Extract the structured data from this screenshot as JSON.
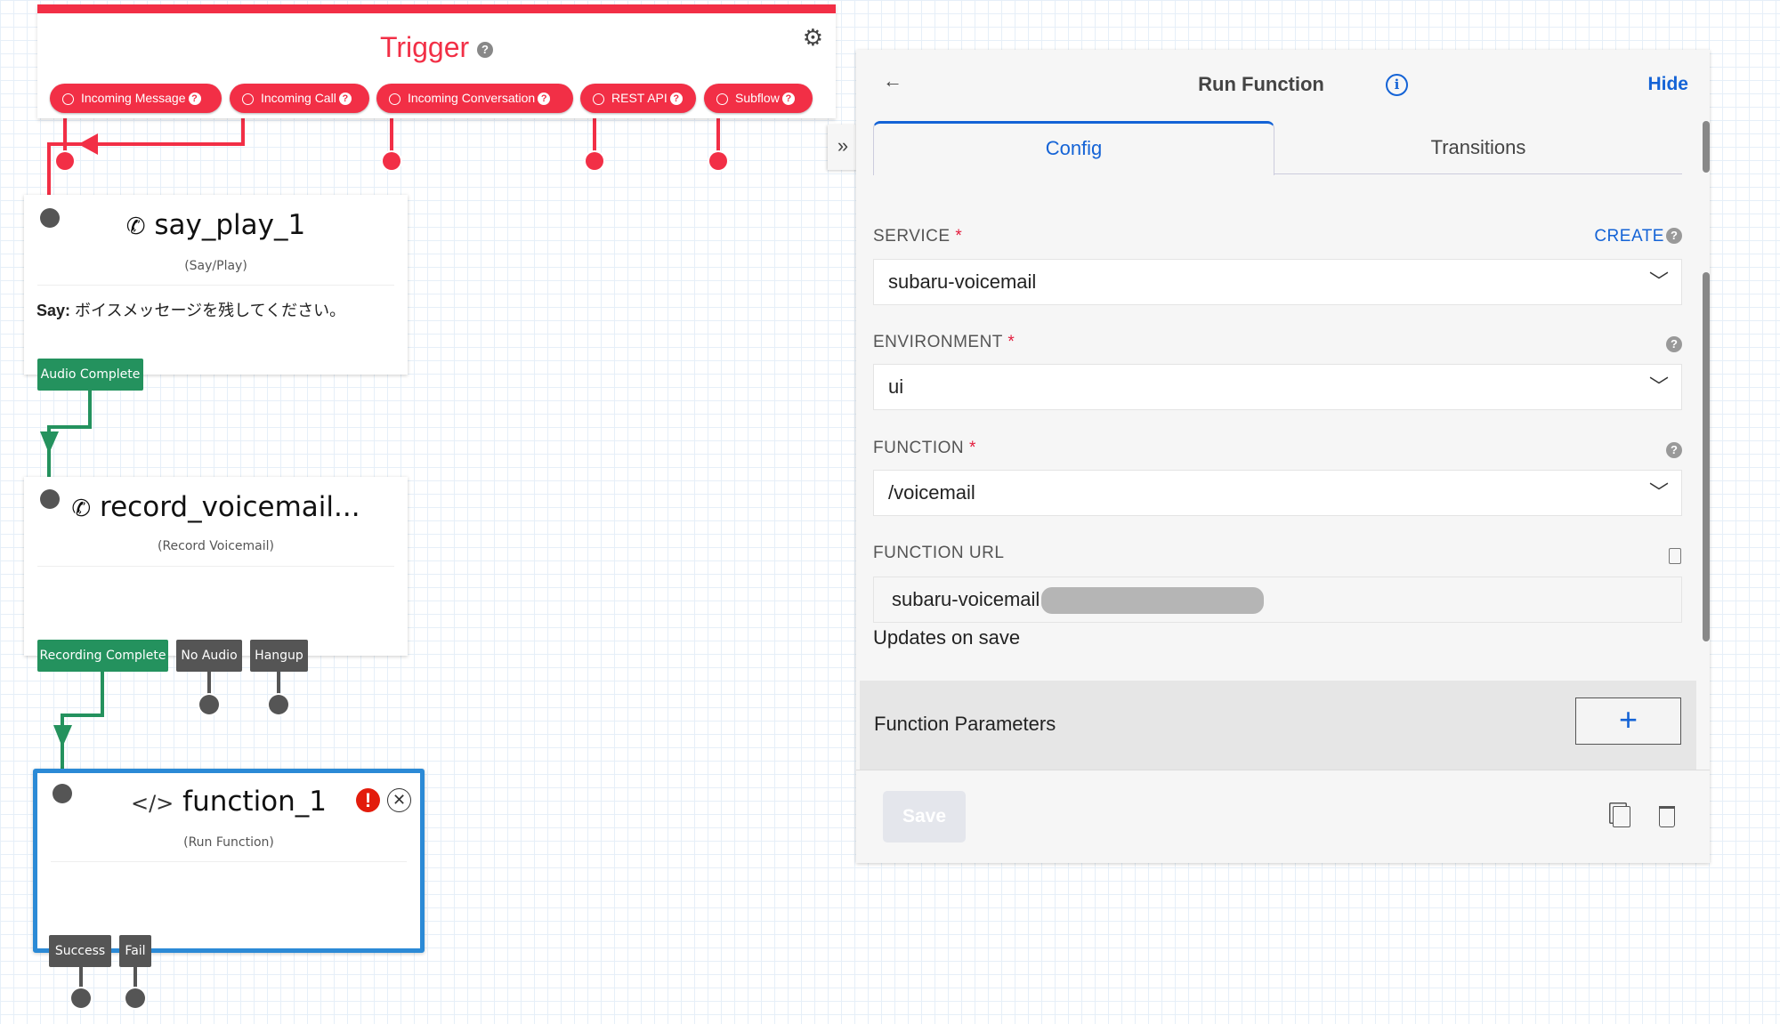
{
  "trigger": {
    "title": "Trigger",
    "help": "?",
    "pills": [
      "Incoming Message",
      "Incoming Call",
      "Incoming Conversation",
      "REST API",
      "Subflow"
    ]
  },
  "widgets": [
    {
      "name": "say_play_1",
      "type": "(Say/Play)",
      "say_label": "Say:",
      "say_text": "ボイスメッセージを残してください。",
      "transitions": [
        "Audio Complete"
      ]
    },
    {
      "name": "record_voicemail...",
      "type": "(Record Voicemail)",
      "transitions": [
        "Recording Complete",
        "No Audio",
        "Hangup"
      ]
    },
    {
      "name": "function_1",
      "type": "(Run Function)",
      "transitions": [
        "Success",
        "Fail"
      ]
    }
  ],
  "panel": {
    "title": "Run Function",
    "hide": "Hide",
    "tabs": [
      "Config",
      "Transitions"
    ],
    "active_tab": "Config",
    "service": {
      "label": "SERVICE",
      "required": "*",
      "create": "CREATE",
      "value": "subaru-voicemail"
    },
    "environment": {
      "label": "ENVIRONMENT",
      "required": "*",
      "value": "ui"
    },
    "function": {
      "label": "FUNCTION",
      "required": "*",
      "value": "/voicemail"
    },
    "function_url": {
      "label": "FUNCTION URL",
      "value": "subaru-voicemail",
      "note": "Updates on save"
    },
    "parameters": {
      "label": "Function Parameters",
      "add": "+"
    },
    "save": "Save"
  },
  "colors": {
    "trigger": "#f22f46",
    "success": "#24925e",
    "neutral": "#555555",
    "selected": "#2b8ad6",
    "link": "#1463d6"
  }
}
